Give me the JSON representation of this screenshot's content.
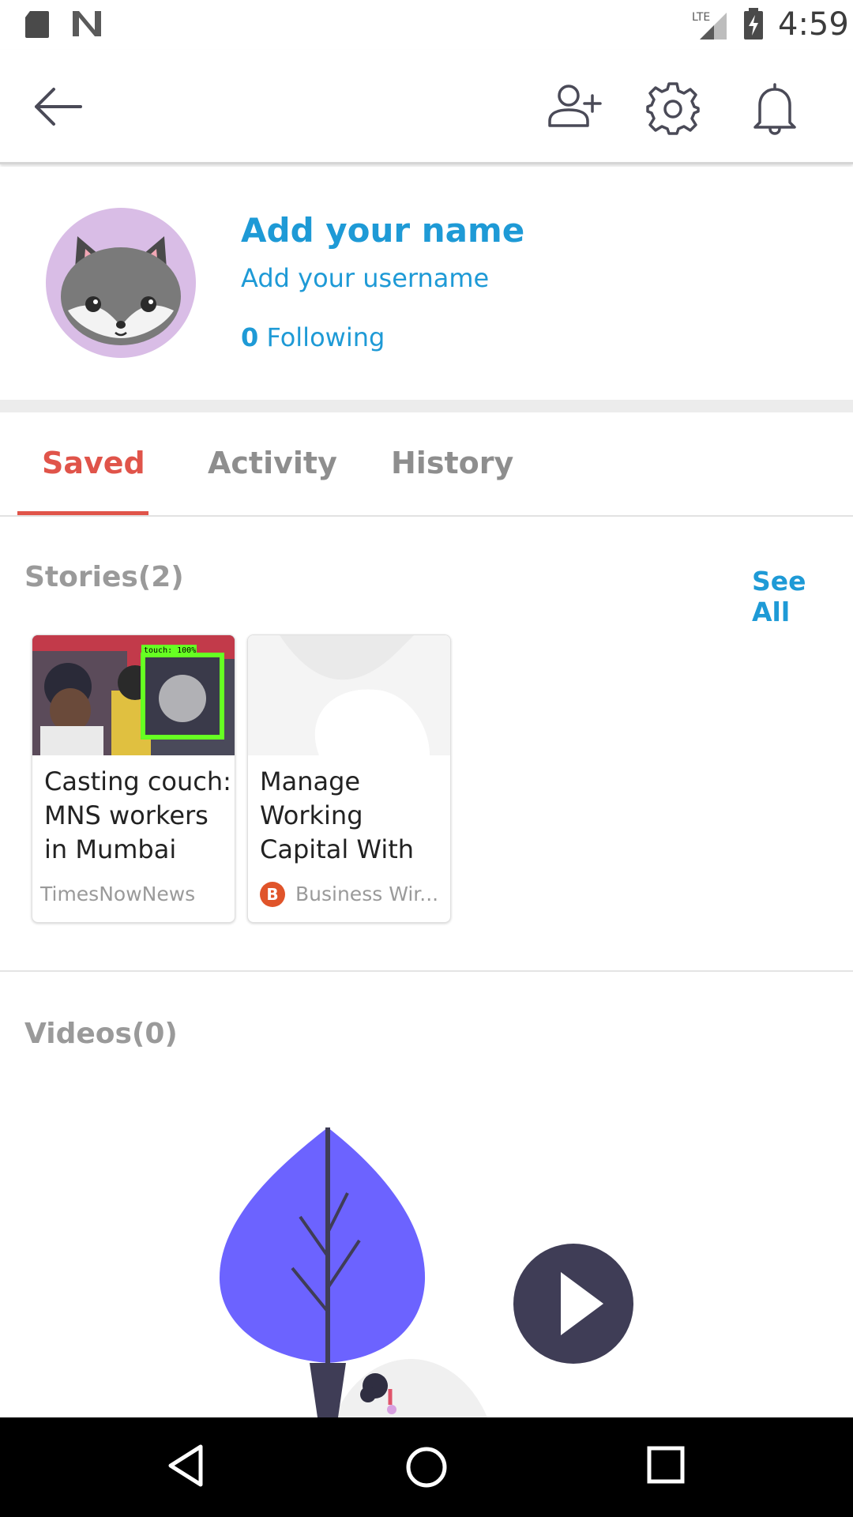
{
  "status_bar": {
    "time": "4:59",
    "network": "LTE",
    "icons": [
      "sd-card-icon",
      "n-logo-icon",
      "lte-signal-icon",
      "battery-charging-icon"
    ]
  },
  "app_bar": {
    "icons": [
      "back-arrow-icon",
      "add-user-icon",
      "gear-icon",
      "bell-icon"
    ]
  },
  "profile": {
    "name": "Add your name",
    "username": "Add your username",
    "following_count": "0",
    "following_label": "Following"
  },
  "tabs": [
    {
      "label": "Saved",
      "active": true
    },
    {
      "label": "Activity",
      "active": false
    },
    {
      "label": "History",
      "active": false
    }
  ],
  "stories": {
    "title": "Stories(2)",
    "see_all": "See All",
    "cards": [
      {
        "headline": "Casting couch: MNS workers in Mumbai",
        "source": "TimesNowNews",
        "thumb_label": "touch: 100%"
      },
      {
        "headline": "Manage Working Capital With",
        "source": "Business Wir...",
        "source_logo": "B"
      }
    ]
  },
  "videos": {
    "title": "Videos(0)"
  },
  "colors": {
    "accent_blue": "#1e9ad6",
    "tab_active": "#e0544a",
    "illustration_purple": "#6c63ff",
    "illustration_dark": "#3f3d56"
  }
}
